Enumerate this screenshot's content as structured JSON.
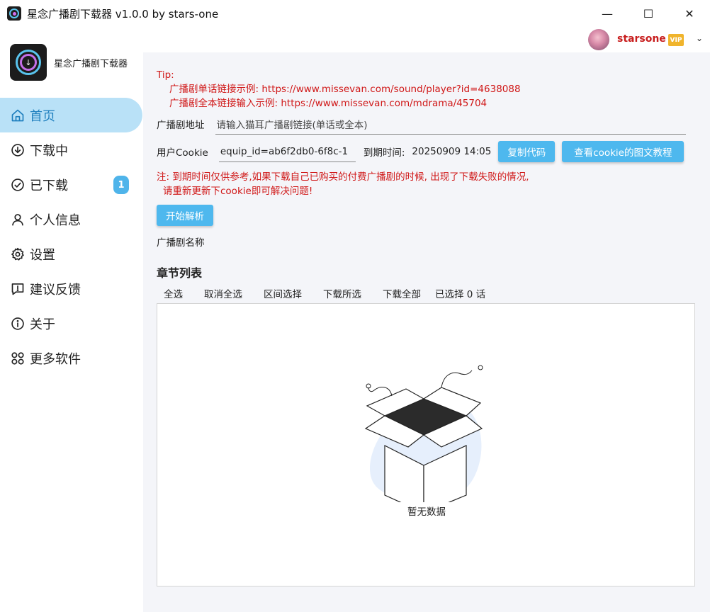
{
  "window": {
    "title": "星念广播剧下载器 v1.0.0 by stars-one",
    "minimize": "—",
    "maximize": "☐",
    "close": "✕"
  },
  "brand": {
    "name": "星念广播剧下载器"
  },
  "nav": {
    "items": [
      {
        "label": "首页",
        "icon": "home-icon",
        "active": true
      },
      {
        "label": "下载中",
        "icon": "download-circle-icon"
      },
      {
        "label": "已下载",
        "icon": "check-circle-icon",
        "badge": "1"
      },
      {
        "label": "个人信息",
        "icon": "user-icon"
      },
      {
        "label": "设置",
        "icon": "gear-icon"
      },
      {
        "label": "建议反馈",
        "icon": "feedback-icon"
      },
      {
        "label": "关于",
        "icon": "info-icon"
      },
      {
        "label": "更多软件",
        "icon": "grid-icon"
      }
    ]
  },
  "user": {
    "name": "starsone",
    "vip": "VIP",
    "dropdown": "⌄"
  },
  "tip": {
    "heading": "Tip:",
    "line1": "广播剧单话链接示例: https://www.missevan.com/sound/player?id=4638088",
    "line2": "广播剧全本链接输入示例: https://www.missevan.com/mdrama/45704"
  },
  "form": {
    "url_label": "广播剧地址",
    "url_placeholder": "请输入猫耳广播剧链接(单话或全本)",
    "cookie_label": "用户Cookie",
    "cookie_value": "equip_id=ab6f2db0-6f8c-1",
    "expire_label": "到期时间:",
    "expire_value": "20250909 14:05",
    "copy_button": "复制代码",
    "tutorial_button": "查看cookie的图文教程"
  },
  "note": {
    "line1": "注: 到期时间仅供参考,如果下载自己已购买的付费广播剧的时候, 出现了下载失败的情况,",
    "line2": "请重新更新下cookie即可解决问题!"
  },
  "parse_button": "开始解析",
  "drama_name_label": "广播剧名称",
  "chapters": {
    "title": "章节列表",
    "select_all": "全选",
    "deselect_all": "取消全选",
    "range_select": "区间选择",
    "download_selected": "下载所选",
    "download_all": "下载全部",
    "selected_count": "已选择 0 话",
    "empty_text": "暂无数据"
  },
  "colors": {
    "accent": "#4eb8ee",
    "active_nav_bg": "#b9e1f7",
    "warning_text": "#d01818",
    "username": "#c81e1e",
    "vip_badge": "#f0b42c"
  }
}
